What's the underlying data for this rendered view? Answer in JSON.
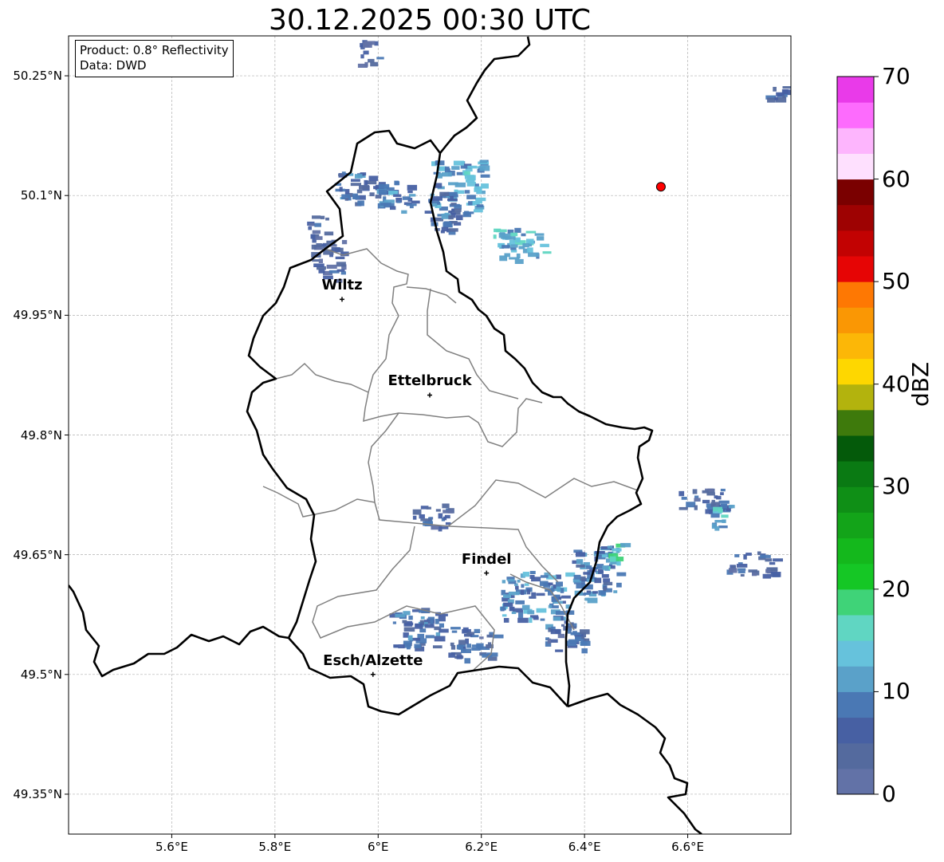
{
  "title": "30.12.2025 00:30 UTC",
  "info_box": {
    "product": "Product: 0.8° Reflectivity",
    "data": "Data: DWD"
  },
  "map": {
    "lon_range": [
      5.4,
      6.8
    ],
    "lat_range": [
      49.3,
      50.3
    ],
    "lat_ticks": [
      {
        "value": 50.25,
        "label": "50.25°N"
      },
      {
        "value": 50.1,
        "label": "50.1°N"
      },
      {
        "value": 49.95,
        "label": "49.95°N"
      },
      {
        "value": 49.8,
        "label": "49.8°N"
      },
      {
        "value": 49.65,
        "label": "49.65°N"
      },
      {
        "value": 49.5,
        "label": "49.5°N"
      },
      {
        "value": 49.35,
        "label": "49.35°N"
      }
    ],
    "lon_ticks": [
      {
        "value": 5.6,
        "label": "5.6°E"
      },
      {
        "value": 5.8,
        "label": "5.8°E"
      },
      {
        "value": 6.0,
        "label": "6°E"
      },
      {
        "value": 6.2,
        "label": "6.2°E"
      },
      {
        "value": 6.4,
        "label": "6.4°E"
      },
      {
        "value": 6.6,
        "label": "6.6°E"
      }
    ],
    "grid": true,
    "cities": [
      {
        "name": "Wiltz",
        "lon": 5.93,
        "lat": 49.97
      },
      {
        "name": "Ettelbruck",
        "lon": 6.1,
        "lat": 49.85
      },
      {
        "name": "Findel",
        "lon": 6.21,
        "lat": 49.627
      },
      {
        "name": "Esch/Alzette",
        "lon": 5.99,
        "lat": 49.5
      }
    ],
    "radar_site": {
      "lon": 6.548,
      "lat": 50.111,
      "color": "#ff0000"
    },
    "echoes": [
      {
        "lon": 5.96,
        "lat": 50.11,
        "w": 0.09,
        "h": 0.04,
        "dbz": 8
      },
      {
        "lon": 6.03,
        "lat": 50.1,
        "w": 0.07,
        "h": 0.04,
        "dbz": 10
      },
      {
        "lon": 5.88,
        "lat": 50.06,
        "w": 0.04,
        "h": 0.03,
        "dbz": 6
      },
      {
        "lon": 5.9,
        "lat": 50.02,
        "w": 0.06,
        "h": 0.05,
        "dbz": 5
      },
      {
        "lon": 6.15,
        "lat": 50.11,
        "w": 0.1,
        "h": 0.07,
        "dbz": 12
      },
      {
        "lon": 6.12,
        "lat": 50.08,
        "w": 0.06,
        "h": 0.05,
        "dbz": 8
      },
      {
        "lon": 6.27,
        "lat": 50.04,
        "w": 0.1,
        "h": 0.04,
        "dbz": 14
      },
      {
        "lon": 5.98,
        "lat": 50.28,
        "w": 0.04,
        "h": 0.03,
        "dbz": 6
      },
      {
        "lon": 6.77,
        "lat": 50.23,
        "w": 0.05,
        "h": 0.02,
        "dbz": 6
      },
      {
        "lon": 6.1,
        "lat": 49.7,
        "w": 0.07,
        "h": 0.03,
        "dbz": 6
      },
      {
        "lon": 6.3,
        "lat": 49.6,
        "w": 0.13,
        "h": 0.06,
        "dbz": 10
      },
      {
        "lon": 6.07,
        "lat": 49.56,
        "w": 0.1,
        "h": 0.05,
        "dbz": 8
      },
      {
        "lon": 6.18,
        "lat": 49.54,
        "w": 0.09,
        "h": 0.04,
        "dbz": 7
      },
      {
        "lon": 6.42,
        "lat": 49.63,
        "w": 0.09,
        "h": 0.07,
        "dbz": 9
      },
      {
        "lon": 6.45,
        "lat": 49.65,
        "w": 0.04,
        "h": 0.03,
        "dbz": 16
      },
      {
        "lon": 6.63,
        "lat": 49.72,
        "w": 0.1,
        "h": 0.03,
        "dbz": 6
      },
      {
        "lon": 6.66,
        "lat": 49.7,
        "w": 0.04,
        "h": 0.03,
        "dbz": 14
      },
      {
        "lon": 6.72,
        "lat": 49.64,
        "w": 0.09,
        "h": 0.03,
        "dbz": 6
      },
      {
        "lon": 6.36,
        "lat": 49.55,
        "w": 0.08,
        "h": 0.04,
        "dbz": 7
      }
    ]
  },
  "colorbar": {
    "label": "dBZ",
    "min": 0,
    "max": 70,
    "step": 2.5,
    "ticks": [
      0,
      10,
      20,
      30,
      40,
      50,
      60,
      70
    ],
    "colors": [
      "#6272a7",
      "#546a9e",
      "#4760a3",
      "#4a78b4",
      "#5aa1c9",
      "#66c2dc",
      "#60d6c2",
      "#3fd378",
      "#15c725",
      "#14b81c",
      "#13a419",
      "#0f8f16",
      "#0a7a13",
      "#045a0a",
      "#3e7a0c",
      "#b3b30d",
      "#fed700",
      "#fcb707",
      "#fa9704",
      "#fe7803",
      "#e60505",
      "#c20202",
      "#9e0202",
      "#7a0000",
      "#fee0fe",
      "#fdb5fd",
      "#fd6bfd",
      "#e93ae9"
    ]
  }
}
